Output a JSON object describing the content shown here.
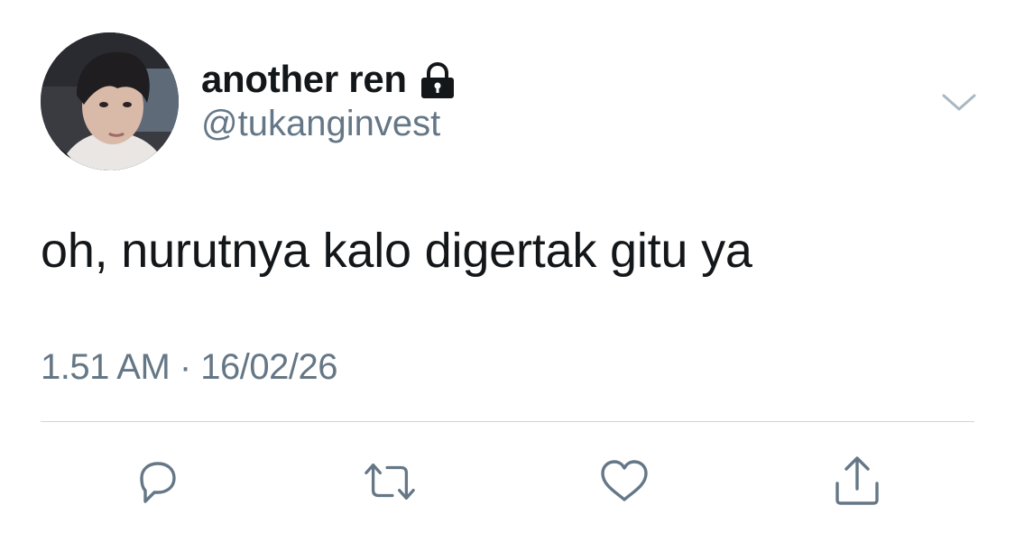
{
  "author": {
    "display_name": "another ren",
    "handle": "@tukanginvest",
    "protected_icon": "lock-icon",
    "avatar_alt": "profile photo"
  },
  "tweet": {
    "text": "oh, nurutnya kalo digertak gitu ya",
    "timestamp": "1.51 AM · 16/02/26"
  },
  "actions": [
    {
      "id": "reply",
      "icon": "reply-icon"
    },
    {
      "id": "retweet",
      "icon": "retweet-icon"
    },
    {
      "id": "like",
      "icon": "heart-icon"
    },
    {
      "id": "share",
      "icon": "share-icon"
    }
  ],
  "colors": {
    "text_primary": "#14171a",
    "text_secondary": "#657786",
    "icon": "#657786",
    "divider": "#ccd6dd",
    "background": "#ffffff"
  }
}
